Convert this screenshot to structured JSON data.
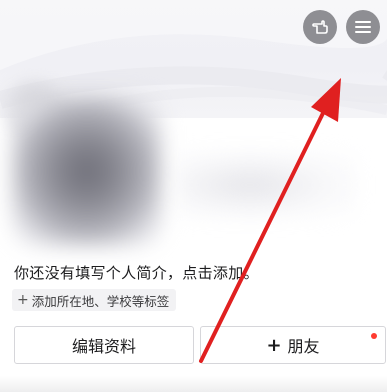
{
  "header": {
    "icons": [
      "hand-pointer-icon",
      "menu-icon"
    ]
  },
  "profile": {
    "bio_prompt": "你还没有填写个人简介，点击添加。",
    "add_tag_label": "添加所在地、学校等标签",
    "add_tag_plus": "+"
  },
  "actions": {
    "edit_profile_label": "编辑资料",
    "add_friend_plus": "+",
    "add_friend_label": "朋友"
  },
  "colors": {
    "annotation_arrow": "#e02020",
    "notification_dot": "#ff3b30",
    "icon_bg": "#8e8e93"
  }
}
